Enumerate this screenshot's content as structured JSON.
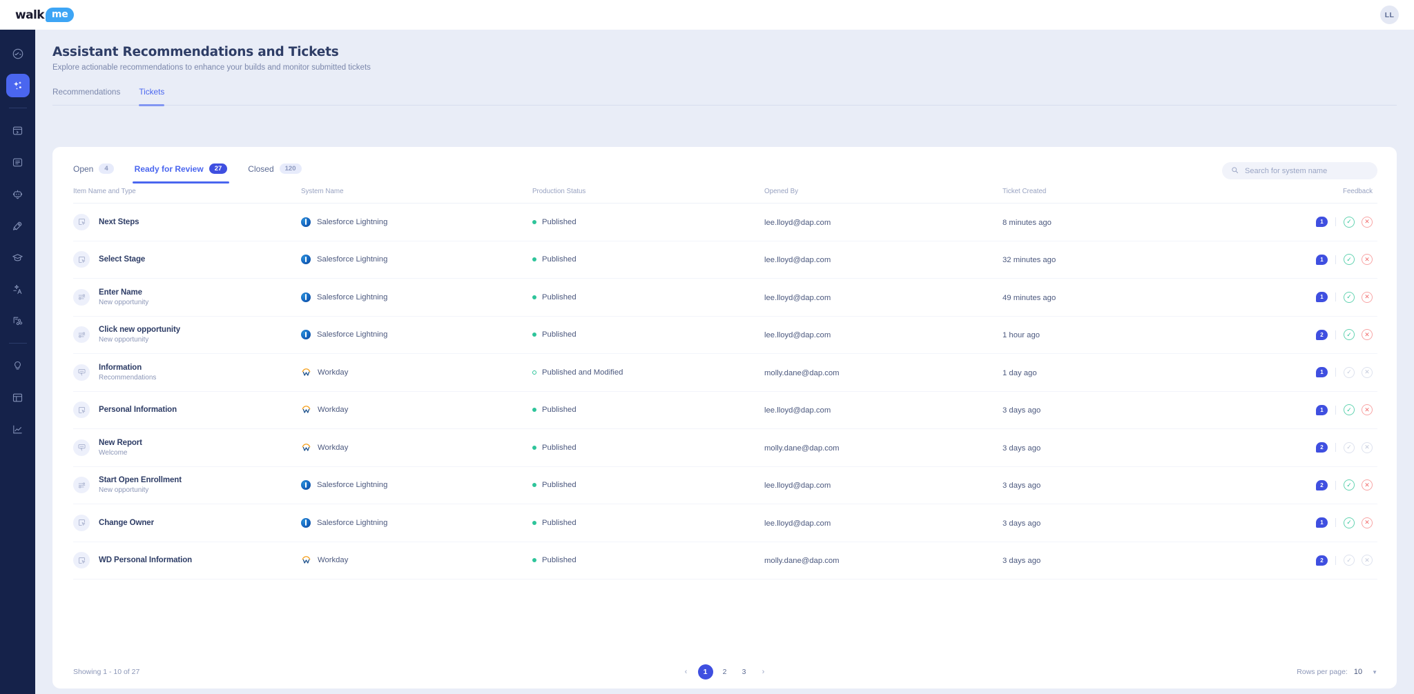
{
  "topbar": {
    "logo_walk": "walk",
    "logo_me": "me",
    "avatar_initials": "LL"
  },
  "sidebar": {
    "items": [
      {
        "name": "dashboard",
        "icon": "speedometer-icon",
        "active": false
      },
      {
        "name": "assistant",
        "icon": "sparkles-icon",
        "active": true
      },
      {
        "name": "builds",
        "icon": "box-arrow-icon",
        "active": false
      },
      {
        "name": "content",
        "icon": "list-panel-icon",
        "active": false
      },
      {
        "name": "bot",
        "icon": "robot-icon",
        "active": false
      },
      {
        "name": "launch",
        "icon": "rocket-icon",
        "active": false
      },
      {
        "name": "learning",
        "icon": "graduation-cap-icon",
        "active": false
      },
      {
        "name": "translation",
        "icon": "translate-icon",
        "active": false
      },
      {
        "name": "integrations",
        "icon": "share-nodes-icon",
        "active": false
      },
      {
        "name": "insights",
        "icon": "lightbulb-icon",
        "active": false
      },
      {
        "name": "reports",
        "icon": "table-icon",
        "active": false
      },
      {
        "name": "analytics",
        "icon": "chart-line-icon",
        "active": false
      }
    ]
  },
  "header": {
    "title": "Assistant Recommendations and Tickets",
    "subtitle": "Explore actionable recommendations to enhance your builds and monitor submitted tickets",
    "tabs": [
      {
        "label": "Recommendations",
        "active": false
      },
      {
        "label": "Tickets",
        "active": true
      }
    ]
  },
  "card": {
    "subtabs": [
      {
        "label": "Open",
        "count": "4",
        "active": false
      },
      {
        "label": "Ready for Review",
        "count": "27",
        "active": true
      },
      {
        "label": "Closed",
        "count": "120",
        "active": false
      }
    ],
    "search": {
      "placeholder": "Search for system name",
      "value": ""
    },
    "columns": [
      "Item Name and Type",
      "System Name",
      "Production Status",
      "Opened By",
      "Ticket Created",
      "Feedback"
    ],
    "rows": [
      {
        "item_name": "Next Steps",
        "item_type": "",
        "item_icon": "cursor-box-icon",
        "system": "Salesforce Lightning",
        "system_icon": "salesforce-icon",
        "status": "Published",
        "status_style": "filled",
        "opened_by": "lee.lloyd@dap.com",
        "created": "8 minutes ago",
        "comments": "1",
        "actions_enabled": true
      },
      {
        "item_name": "Select Stage",
        "item_type": "",
        "item_icon": "cursor-box-icon",
        "system": "Salesforce Lightning",
        "system_icon": "salesforce-icon",
        "status": "Published",
        "status_style": "filled",
        "opened_by": "lee.lloyd@dap.com",
        "created": "32 minutes ago",
        "comments": "1",
        "actions_enabled": true
      },
      {
        "item_name": "Enter Name",
        "item_type": "New opportunity",
        "item_icon": "smart-walkthru-icon",
        "system": "Salesforce Lightning",
        "system_icon": "salesforce-icon",
        "status": "Published",
        "status_style": "filled",
        "opened_by": "lee.lloyd@dap.com",
        "created": "49 minutes ago",
        "comments": "1",
        "actions_enabled": true
      },
      {
        "item_name": "Click new opportunity",
        "item_type": "New opportunity",
        "item_icon": "smart-walkthru-icon",
        "system": "Salesforce Lightning",
        "system_icon": "salesforce-icon",
        "status": "Published",
        "status_style": "filled",
        "opened_by": "lee.lloyd@dap.com",
        "created": "1 hour ago",
        "comments": "2",
        "actions_enabled": true
      },
      {
        "item_name": "Information",
        "item_type": "Recommendations",
        "item_icon": "tooltip-icon",
        "system": "Workday",
        "system_icon": "workday-icon",
        "status": "Published and Modified",
        "status_style": "hollow",
        "opened_by": "molly.dane@dap.com",
        "created": "1 day ago",
        "comments": "1",
        "actions_enabled": false
      },
      {
        "item_name": "Personal Information",
        "item_type": "",
        "item_icon": "cursor-box-icon",
        "system": "Workday",
        "system_icon": "workday-icon",
        "status": "Published",
        "status_style": "filled",
        "opened_by": "lee.lloyd@dap.com",
        "created": "3 days ago",
        "comments": "1",
        "actions_enabled": true
      },
      {
        "item_name": "New Report",
        "item_type": "Welcome",
        "item_icon": "tooltip-icon",
        "system": "Workday",
        "system_icon": "workday-icon",
        "status": "Published",
        "status_style": "filled",
        "opened_by": "molly.dane@dap.com",
        "created": "3 days ago",
        "comments": "2",
        "actions_enabled": false
      },
      {
        "item_name": "Start Open Enrollment",
        "item_type": "New opportunity",
        "item_icon": "smart-walkthru-icon",
        "system": "Salesforce Lightning",
        "system_icon": "salesforce-icon",
        "status": "Published",
        "status_style": "filled",
        "opened_by": "lee.lloyd@dap.com",
        "created": "3 days ago",
        "comments": "2",
        "actions_enabled": true
      },
      {
        "item_name": "Change Owner",
        "item_type": "",
        "item_icon": "cursor-box-icon",
        "system": "Salesforce Lightning",
        "system_icon": "salesforce-icon",
        "status": "Published",
        "status_style": "filled",
        "opened_by": "lee.lloyd@dap.com",
        "created": "3 days ago",
        "comments": "1",
        "actions_enabled": true
      },
      {
        "item_name": "WD Personal Information",
        "item_type": "",
        "item_icon": "cursor-box-icon",
        "system": "Workday",
        "system_icon": "workday-icon",
        "status": "Published",
        "status_style": "filled",
        "opened_by": "molly.dane@dap.com",
        "created": "3 days ago",
        "comments": "2",
        "actions_enabled": false
      }
    ],
    "footer": {
      "showing": "Showing 1 - 10 of 27",
      "pages": [
        "1",
        "2",
        "3"
      ],
      "current_page": "1",
      "prev_icon": "chevron-left-icon",
      "next_icon": "chevron-right-icon",
      "rows_per_page_label": "Rows per page:",
      "rows_per_page_value": "10"
    }
  },
  "colors": {
    "accent": "#4a66ef",
    "accent_dark": "#3f4fe0",
    "sidebar": "#15224a",
    "page_bg": "#e9edf7",
    "published": "#2ec49a",
    "reject": "#f26d6d",
    "title": "#2e3d66"
  }
}
